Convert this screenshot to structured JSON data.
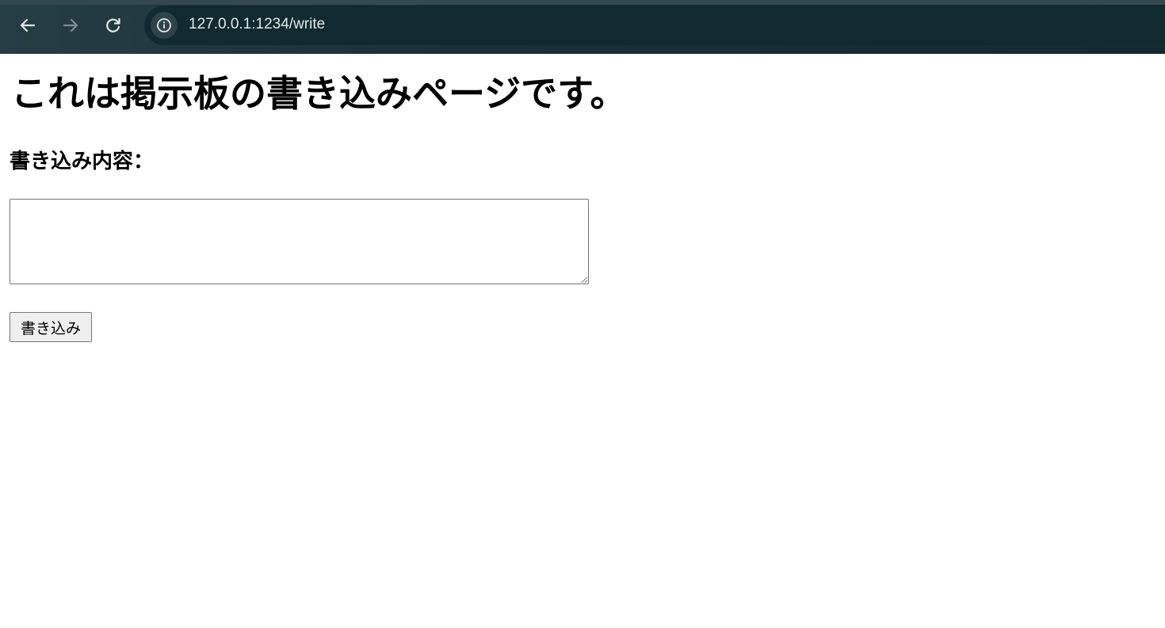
{
  "browser": {
    "url": "127.0.0.1:1234/write",
    "icons": {
      "back": "arrow-left-icon",
      "forward": "arrow-right-icon",
      "reload": "reload-icon",
      "site_info": "info-icon"
    }
  },
  "page": {
    "heading": "これは掲示板の書き込みページです。",
    "field_label": "書き込み内容：",
    "textarea_value": "",
    "submit_label": "書き込み"
  }
}
